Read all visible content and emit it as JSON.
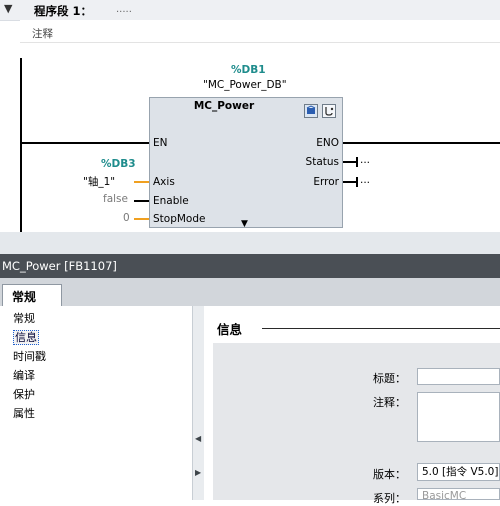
{
  "editor": {
    "segment_title": "程序段 1：",
    "segment_title_extra": ".....",
    "comment_label": "注释",
    "instance_db": "%DB1",
    "instance_db_name": "\"MC_Power_DB\"",
    "block_name": "MC_Power",
    "pins_left": [
      "EN",
      "Axis",
      "Enable",
      "StopMode"
    ],
    "pins_right": [
      "ENO",
      "Status",
      "Error"
    ],
    "axis_db": "%DB3",
    "axis_value": "\"轴_1\"",
    "enable_value": "false",
    "stopmode_value": "0",
    "status_conn": "...",
    "error_conn": "..."
  },
  "inspector": {
    "title": "MC_Power [FB1107]",
    "tab_general": "常规",
    "nav_items": [
      "常规",
      "信息",
      "时间戳",
      "编译",
      "保护",
      "属性"
    ],
    "selected_nav": "信息",
    "section_heading": "信息",
    "fields": {
      "title_label": "标题：",
      "comment_label": "注释：",
      "version_label": "版本：",
      "version_value": "5.0 [指令 V5.0]",
      "family_label": "系列：",
      "family_value": "BasicMC"
    }
  },
  "colors": {
    "db_teal": "#1e8c8c",
    "inspector_title_bg": "#4a4f55",
    "block_fill": "#dde2e8"
  }
}
